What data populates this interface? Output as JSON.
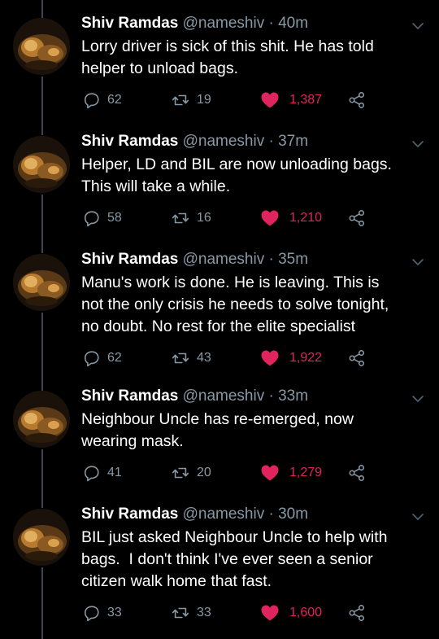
{
  "colors": {
    "background": "#000000",
    "text": "#ffffff",
    "muted": "#8899a6",
    "like": "#e0245e",
    "thread_line": "#3d4752"
  },
  "icons": {
    "reply": "reply-icon",
    "retweet": "retweet-icon",
    "like": "heart-icon",
    "share": "share-icon",
    "menu": "chevron-down-icon"
  },
  "tweets": [
    {
      "name": "Shiv Ramdas",
      "handle": "@nameshiv",
      "separator": "·",
      "time": "40m",
      "lines": [
        "Lorry driver is sick of this shit. He has told",
        "helper to unload bags."
      ],
      "replies": "62",
      "retweets": "19",
      "likes": "1,387"
    },
    {
      "name": "Shiv Ramdas",
      "handle": "@nameshiv",
      "separator": "·",
      "time": "37m",
      "lines": [
        "Helper, LD and BIL are now unloading bags.",
        "This will take a while."
      ],
      "replies": "58",
      "retweets": "16",
      "likes": "1,210"
    },
    {
      "name": "Shiv Ramdas",
      "handle": "@nameshiv",
      "separator": "·",
      "time": "35m",
      "lines": [
        "Manu's work is done. He is leaving. This is",
        "not the only crisis he needs to solve tonight,",
        "no doubt. No rest for the elite specialist"
      ],
      "replies": "62",
      "retweets": "43",
      "likes": "1,922"
    },
    {
      "name": "Shiv Ramdas",
      "handle": "@nameshiv",
      "separator": "·",
      "time": "33m",
      "lines": [
        "Neighbour Uncle has re-emerged, now",
        "wearing mask."
      ],
      "replies": "41",
      "retweets": "20",
      "likes": "1,279"
    },
    {
      "name": "Shiv Ramdas",
      "handle": "@nameshiv",
      "separator": "·",
      "time": "30m",
      "lines": [
        "BIL just asked Neighbour Uncle to help with",
        "bags.  I don't think I've ever seen a senior",
        "citizen walk home that fast."
      ],
      "replies": "33",
      "retweets": "33",
      "likes": "1,600"
    }
  ]
}
